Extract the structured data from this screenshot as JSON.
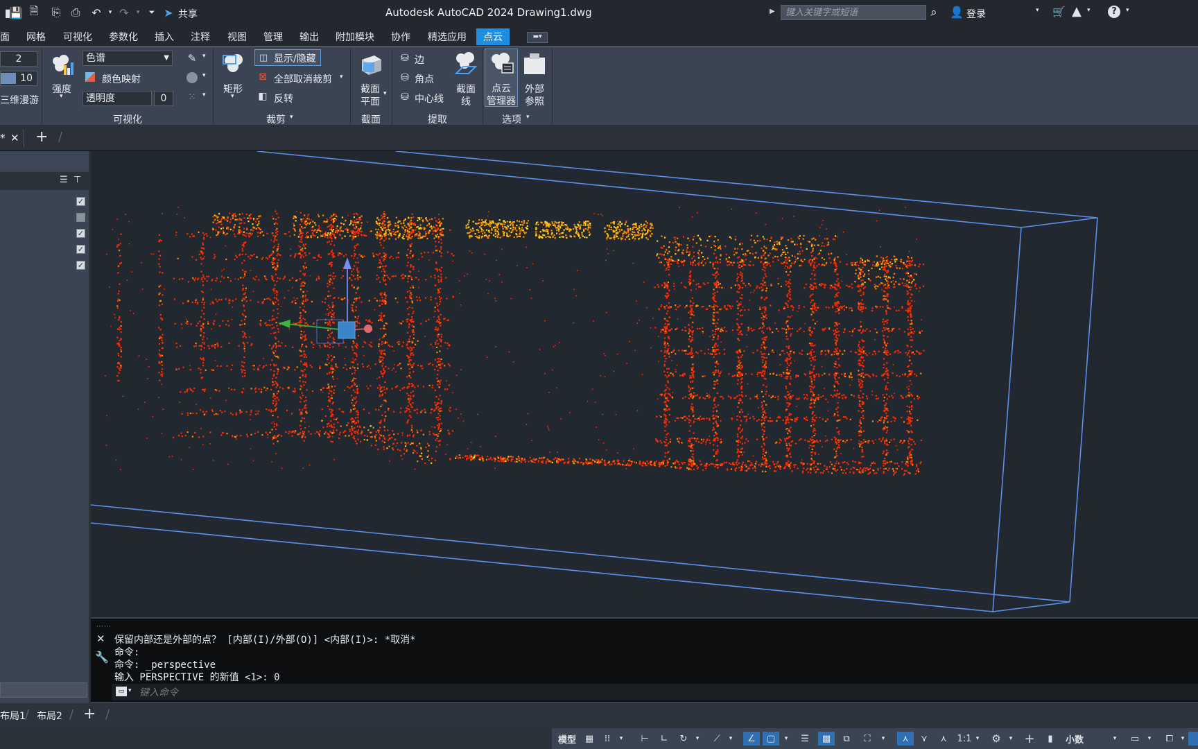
{
  "app": {
    "title": "Autodesk AutoCAD 2024    Drawing1.dwg"
  },
  "quick_access": {
    "share_label": "共享"
  },
  "search": {
    "placeholder": "键入关键字或短语"
  },
  "account": {
    "login_label": "登录"
  },
  "menu_tabs": [
    "面",
    "网格",
    "可视化",
    "参数化",
    "插入",
    "注释",
    "视图",
    "管理",
    "输出",
    "附加模块",
    "协作",
    "精选应用",
    "点云"
  ],
  "active_tab": "点云",
  "ribbon": {
    "left_values": {
      "value1": "2",
      "value2": "10",
      "nav_label": "三维漫游"
    },
    "visualize": {
      "intensity_label": "强度",
      "stylize_value": "色谱",
      "color_map_label": "颜色映射",
      "transparency_label": "透明度",
      "transparency_value": "0",
      "panel_title": "可视化"
    },
    "crop": {
      "rect_label": "矩形",
      "show_hide_label": "显示/隐藏",
      "uncrop_all_label": "全部取消裁剪",
      "invert_label": "反转",
      "panel_title": "裁剪"
    },
    "section": {
      "plane_label": "截面\n平面",
      "plane_line1": "截面",
      "plane_line2": "平面",
      "panel_title": "截面"
    },
    "extract": {
      "edge_label": "边",
      "corner_label": "角点",
      "centerline_label": "中心线",
      "section_line1": "截面",
      "section_line2": "线",
      "panel_title": "提取"
    },
    "options": {
      "manager_line1": "点云",
      "manager_line2": "管理器",
      "xref_line1": "外部",
      "xref_line2": "参照",
      "panel_title": "选项"
    }
  },
  "file_tabs": {
    "current": "*",
    "add": "+"
  },
  "command": {
    "lines": [
      "保留内部还是外部的点？ [内部(I)/外部(O)] <内部(I)>: *取消*",
      "命令:",
      "命令: _perspective",
      "输入 PERSPECTIVE 的新值 <1>: 0"
    ],
    "placeholder": "键入命令"
  },
  "layout_tabs": [
    "布局1",
    "布局2"
  ],
  "status": {
    "model_label": "模型",
    "scale_label": "1:1",
    "units_label": "小数"
  },
  "colors": {
    "accent": "#1f8ee0",
    "cloud_red": "#ff2a00",
    "cloud_orange": "#ff8a00",
    "cloud_yellow": "#ffd21f",
    "box_line": "#5e8fe8"
  }
}
